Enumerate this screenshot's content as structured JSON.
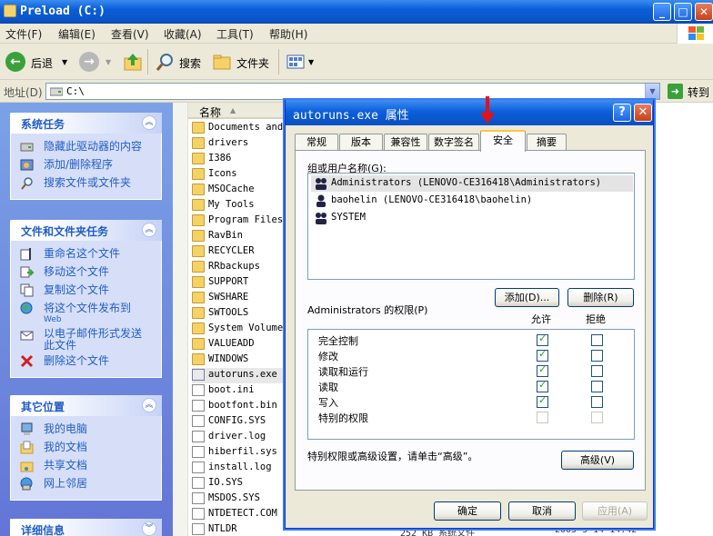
{
  "window": {
    "title": "Preload (C:)",
    "minimize": "_",
    "maximize": "□",
    "close": "✕"
  },
  "menu": [
    "文件(F)",
    "编辑(E)",
    "查看(V)",
    "收藏(A)",
    "工具(T)",
    "帮助(H)"
  ],
  "toolbar": {
    "back_label": "后退",
    "search_label": "搜索",
    "folders_label": "文件夹"
  },
  "address": {
    "label": "地址(D)",
    "value": "C:\\",
    "go_label": "转到"
  },
  "system_tasks": {
    "title": "系统任务",
    "items": [
      "隐藏此驱动器的内容",
      "添加/删除程序",
      "搜索文件或文件夹"
    ]
  },
  "file_tasks": {
    "title": "文件和文件夹任务",
    "items": [
      "重命名这个文件",
      "移动这个文件",
      "复制这个文件",
      "将这个文件发布到",
      "以电子邮件形式发送此文件",
      "删除这个文件"
    ],
    "publish_sub": "Web"
  },
  "other_places": {
    "title": "其它位置",
    "items": [
      "我的电脑",
      "我的文档",
      "共享文档",
      "网上邻居"
    ]
  },
  "details": {
    "title": "详细信息"
  },
  "file_list": {
    "column_name": "名称",
    "files": [
      {
        "name": "Documents and",
        "type": "folder"
      },
      {
        "name": "drivers",
        "type": "folder"
      },
      {
        "name": "I386",
        "type": "folder"
      },
      {
        "name": "Icons",
        "type": "folder"
      },
      {
        "name": "MSOCache",
        "type": "folder"
      },
      {
        "name": "My Tools",
        "type": "folder"
      },
      {
        "name": "Program Files",
        "type": "folder"
      },
      {
        "name": "RavBin",
        "type": "folder"
      },
      {
        "name": "RECYCLER",
        "type": "folder"
      },
      {
        "name": "RRbackups",
        "type": "folder"
      },
      {
        "name": "SUPPORT",
        "type": "folder"
      },
      {
        "name": "SWSHARE",
        "type": "folder"
      },
      {
        "name": "SWTOOLS",
        "type": "folder"
      },
      {
        "name": "System Volume",
        "type": "folder"
      },
      {
        "name": "VALUEADD",
        "type": "folder"
      },
      {
        "name": "WINDOWS",
        "type": "folder"
      },
      {
        "name": "autoruns.exe",
        "type": "exe"
      },
      {
        "name": "boot.ini",
        "type": "doc"
      },
      {
        "name": "bootfont.bin",
        "type": "doc"
      },
      {
        "name": "CONFIG.SYS",
        "type": "doc"
      },
      {
        "name": "driver.log",
        "type": "doc"
      },
      {
        "name": "hiberfil.sys",
        "type": "doc"
      },
      {
        "name": "install.log",
        "type": "doc"
      },
      {
        "name": "IO.SYS",
        "type": "doc"
      },
      {
        "name": "MSDOS.SYS",
        "type": "doc"
      },
      {
        "name": "NTDETECT.COM",
        "type": "doc"
      },
      {
        "name": "NTLDR",
        "type": "doc"
      }
    ],
    "footer_size": "252 KB  系统文件",
    "footer_date": "2005-3-14 14:42"
  },
  "dialog": {
    "title": "autoruns.exe 属性",
    "help": "?",
    "close": "✕",
    "tabs": [
      "常规",
      "版本",
      "兼容性",
      "数字签名",
      "安全",
      "摘要"
    ],
    "active_tab": "安全",
    "group_label": "组或用户名称(G):",
    "users": [
      "Administrators (LENOVO-CE316418\\Administrators)",
      "baohelin (LENOVO-CE316418\\baohelin)",
      "SYSTEM"
    ],
    "add_button": "添加(D)...",
    "remove_button": "删除(R)",
    "perm_label": "Administrators 的权限(P)",
    "allow_header": "允许",
    "deny_header": "拒绝",
    "permissions": [
      {
        "name": "完全控制",
        "allow": true,
        "deny": false,
        "disabled": false
      },
      {
        "name": "修改",
        "allow": true,
        "deny": false,
        "disabled": false
      },
      {
        "name": "读取和运行",
        "allow": true,
        "deny": false,
        "disabled": false
      },
      {
        "name": "读取",
        "allow": true,
        "deny": false,
        "disabled": false
      },
      {
        "name": "写入",
        "allow": true,
        "deny": false,
        "disabled": false
      },
      {
        "name": "特别的权限",
        "allow": false,
        "deny": false,
        "disabled": true
      }
    ],
    "advanced_text": "特别权限或高级设置，请单击“高级”。",
    "advanced_button": "高级(V)",
    "ok_button": "确定",
    "cancel_button": "取消",
    "apply_button": "应用(A)"
  }
}
